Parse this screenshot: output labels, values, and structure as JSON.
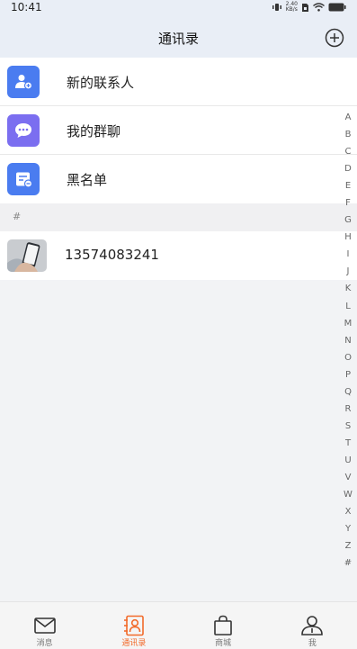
{
  "status_bar": {
    "time": "10:41",
    "net_speed_value": "2.40",
    "net_speed_unit": "KB/s"
  },
  "nav": {
    "title": "通讯录"
  },
  "menu": [
    {
      "label": "新的联系人",
      "icon": "add-contact-icon",
      "color": "#4a7cf0"
    },
    {
      "label": "我的群聊",
      "icon": "chat-bubble-icon",
      "color": "#7b6ef0"
    },
    {
      "label": "黑名单",
      "icon": "blacklist-icon",
      "color": "#4a7cf0"
    }
  ],
  "section": {
    "letter": "#"
  },
  "contacts": [
    {
      "name": "13574083241",
      "avatar": "phone-photo-avatar"
    }
  ],
  "index": [
    "A",
    "B",
    "C",
    "D",
    "E",
    "F",
    "G",
    "H",
    "I",
    "J",
    "K",
    "L",
    "M",
    "N",
    "O",
    "P",
    "Q",
    "R",
    "S",
    "T",
    "U",
    "V",
    "W",
    "X",
    "Y",
    "Z",
    "#"
  ],
  "tabs": [
    {
      "label": "消息",
      "icon": "mail-icon",
      "active": false
    },
    {
      "label": "通讯录",
      "icon": "contacts-icon",
      "active": true
    },
    {
      "label": "商城",
      "icon": "shopping-bag-icon",
      "active": false
    },
    {
      "label": "我",
      "icon": "user-icon",
      "active": false
    }
  ],
  "colors": {
    "accent": "#f26a2a",
    "nav_bg": "#e9eef6",
    "icon_blue": "#4a7cf0",
    "icon_purple": "#7b6ef0"
  }
}
